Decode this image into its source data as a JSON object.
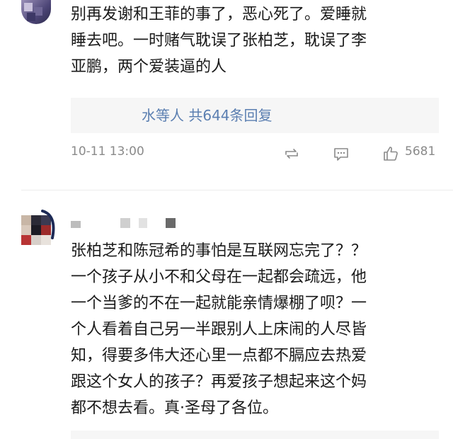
{
  "comment1": {
    "text": "别再发谢和王菲的事了，恶心死了。爱睡就\n睡去吧。一时赌气耽误了张柏芝，耽误了李\n亚鹏，两个爱装逼的人",
    "replies_label": "水等人 共644条回复",
    "time": "10-11 13:00",
    "likes": "5681"
  },
  "comment2": {
    "text": "张柏芝和陈冠希的事怕是互联网忘完了？？\n一个孩子从小不和父母在一起都会疏远，他\n一个当爹的不在一起就能亲情爆棚了呗？一\n个人看着自己另一半跟别人上床闹的人尽皆\n知，得要多伟大还心里一点都不膈应去热爱\n跟这个女人的孩子？再爱孩子想起来这个妈\n都不想去看。真·圣母了各位。"
  },
  "icons": {
    "repost": "repost-icon",
    "comment": "comment-icon",
    "like": "like-icon"
  },
  "colors": {
    "link": "#5b7fb1",
    "meta": "#8a8a8a",
    "reply_bg": "#f6f6f6"
  }
}
